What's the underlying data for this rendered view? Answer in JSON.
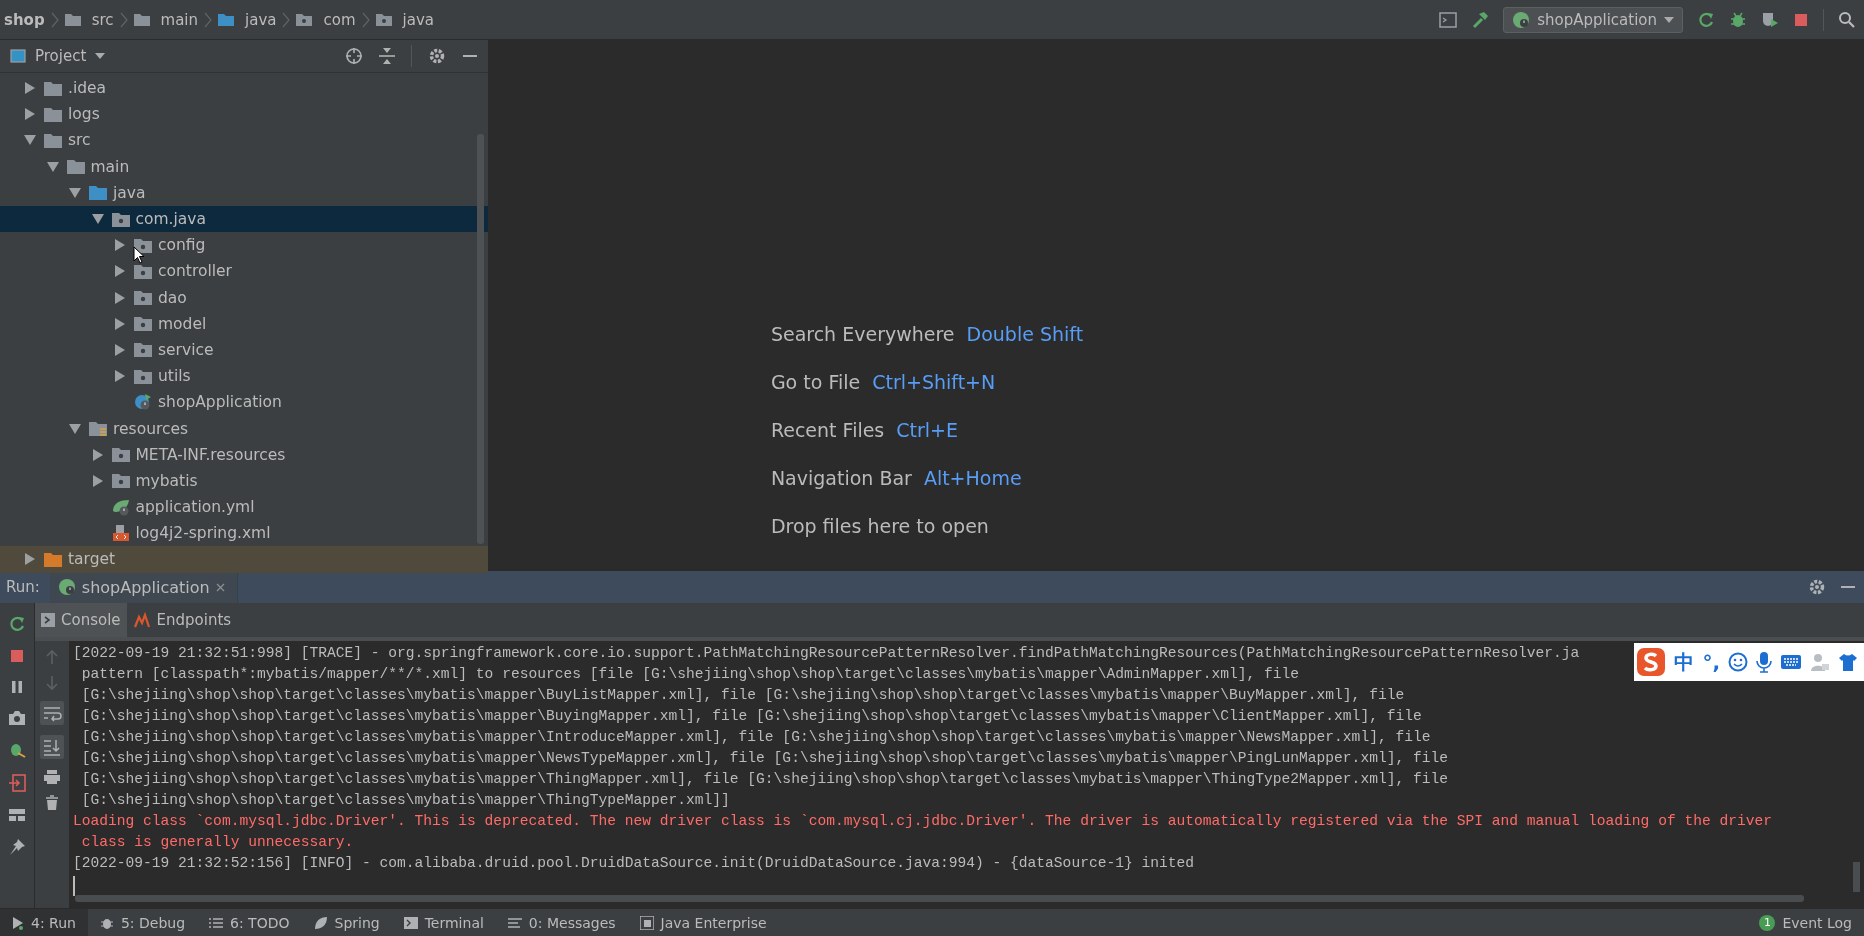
{
  "breadcrumbs": [
    {
      "label": "shop",
      "kind": "project"
    },
    {
      "label": "src",
      "kind": "folder"
    },
    {
      "label": "main",
      "kind": "folder"
    },
    {
      "label": "java",
      "kind": "source"
    },
    {
      "label": "com",
      "kind": "package"
    },
    {
      "label": "java",
      "kind": "package"
    }
  ],
  "run_config": {
    "label": "shopApplication"
  },
  "project_panel": {
    "title": "Project",
    "tree": [
      {
        "label": ".idea",
        "kind": "folder",
        "expanded": false,
        "selected": false
      },
      {
        "label": "logs",
        "kind": "folder",
        "expanded": false,
        "selected": false
      },
      {
        "label": "src",
        "kind": "folder",
        "expanded": true,
        "selected": false,
        "children": [
          {
            "label": "main",
            "kind": "folder",
            "expanded": true,
            "selected": false,
            "children": [
              {
                "label": "java",
                "kind": "source",
                "expanded": true,
                "selected": false,
                "children": [
                  {
                    "label": "com.java",
                    "kind": "package",
                    "expanded": true,
                    "selected": true,
                    "children": [
                      {
                        "label": "config",
                        "kind": "package",
                        "expanded": false,
                        "selected": false
                      },
                      {
                        "label": "controller",
                        "kind": "package",
                        "expanded": false,
                        "selected": false
                      },
                      {
                        "label": "dao",
                        "kind": "package",
                        "expanded": false,
                        "selected": false
                      },
                      {
                        "label": "model",
                        "kind": "package",
                        "expanded": false,
                        "selected": false
                      },
                      {
                        "label": "service",
                        "kind": "package",
                        "expanded": false,
                        "selected": false
                      },
                      {
                        "label": "utils",
                        "kind": "package",
                        "expanded": false,
                        "selected": false
                      },
                      {
                        "label": "shopApplication",
                        "kind": "spring",
                        "selected": false
                      }
                    ]
                  }
                ]
              },
              {
                "label": "resources",
                "kind": "resources",
                "expanded": true,
                "selected": false,
                "children": [
                  {
                    "label": "META-INF.resources",
                    "kind": "package",
                    "expanded": false,
                    "selected": false
                  },
                  {
                    "label": "mybatis",
                    "kind": "package",
                    "expanded": false,
                    "selected": false
                  },
                  {
                    "label": "application.yml",
                    "kind": "yml",
                    "selected": false
                  },
                  {
                    "label": "log4j2-spring.xml",
                    "kind": "xml",
                    "selected": false
                  }
                ]
              }
            ]
          }
        ]
      },
      {
        "label": "target",
        "kind": "excluded",
        "expanded": false,
        "selected": false
      }
    ]
  },
  "editor_hints": [
    {
      "label": "Search Everywhere",
      "shortcut": "Double Shift"
    },
    {
      "label": "Go to File",
      "shortcut": "Ctrl+Shift+N"
    },
    {
      "label": "Recent Files",
      "shortcut": "Ctrl+E"
    },
    {
      "label": "Navigation Bar",
      "shortcut": "Alt+Home"
    },
    {
      "label": "Drop files here to open"
    }
  ],
  "run_panel": {
    "label": "Run:",
    "tab": "shopApplication",
    "subtabs": [
      {
        "label": "Console",
        "selected": true
      },
      {
        "label": "Endpoints",
        "selected": false
      }
    ],
    "console": [
      {
        "kind": "info",
        "text": "[2022-09-19 21:32:51:998] [TRACE] - org.springframework.core.io.support.PathMatchingResourcePatternResolver.findPathMatchingResources(PathMatchingResourcePatternResolver.ja"
      },
      {
        "kind": "info",
        "text": " pattern [classpath*:mybatis/mapper/**/*.xml] to resources [file [G:\\shejiing\\shop\\shop\\target\\classes\\mybatis\\mapper\\AdminMapper.xml], file"
      },
      {
        "kind": "info",
        "text": " [G:\\shejiing\\shop\\shop\\target\\classes\\mybatis\\mapper\\BuyListMapper.xml], file [G:\\shejiing\\shop\\shop\\target\\classes\\mybatis\\mapper\\BuyMapper.xml], file"
      },
      {
        "kind": "info",
        "text": " [G:\\shejiing\\shop\\shop\\target\\classes\\mybatis\\mapper\\BuyingMapper.xml], file [G:\\shejiing\\shop\\shop\\target\\classes\\mybatis\\mapper\\ClientMapper.xml], file"
      },
      {
        "kind": "info",
        "text": " [G:\\shejiing\\shop\\shop\\target\\classes\\mybatis\\mapper\\IntroduceMapper.xml], file [G:\\shejiing\\shop\\shop\\target\\classes\\mybatis\\mapper\\NewsMapper.xml], file"
      },
      {
        "kind": "info",
        "text": " [G:\\shejiing\\shop\\shop\\target\\classes\\mybatis\\mapper\\NewsTypeMapper.xml], file [G:\\shejiing\\shop\\shop\\target\\classes\\mybatis\\mapper\\PingLunMapper.xml], file"
      },
      {
        "kind": "info",
        "text": " [G:\\shejiing\\shop\\shop\\target\\classes\\mybatis\\mapper\\ThingMapper.xml], file [G:\\shejiing\\shop\\shop\\target\\classes\\mybatis\\mapper\\ThingType2Mapper.xml], file"
      },
      {
        "kind": "info",
        "text": " [G:\\shejiing\\shop\\shop\\target\\classes\\mybatis\\mapper\\ThingTypeMapper.xml]]"
      },
      {
        "kind": "error",
        "text": "Loading class `com.mysql.jdbc.Driver'. This is deprecated. The new driver class is `com.mysql.cj.jdbc.Driver'. The driver is automatically registered via the SPI and manual loading of the driver"
      },
      {
        "kind": "error",
        "text": " class is generally unnecessary."
      },
      {
        "kind": "info",
        "text": "[2022-09-19 21:32:52:156] [INFO] - com.alibaba.druid.pool.DruidDataSource.init(DruidDataSource.java:994) - {dataSource-1} inited"
      }
    ]
  },
  "ime_toolbar": {
    "mode": "中",
    "punctuation": "°,"
  },
  "bottom_tabs": [
    {
      "label": "4: Run",
      "kind": "run",
      "selected": true
    },
    {
      "label": "5: Debug",
      "kind": "debug",
      "selected": false
    },
    {
      "label": "6: TODO",
      "kind": "todo",
      "selected": false
    },
    {
      "label": "Spring",
      "kind": "spring",
      "selected": false
    },
    {
      "label": "Terminal",
      "kind": "terminal",
      "selected": false
    },
    {
      "label": "0: Messages",
      "kind": "messages",
      "selected": false
    },
    {
      "label": "Java Enterprise",
      "kind": "javaee",
      "selected": false
    }
  ],
  "event_log": {
    "label": "Event Log",
    "count": "1"
  }
}
